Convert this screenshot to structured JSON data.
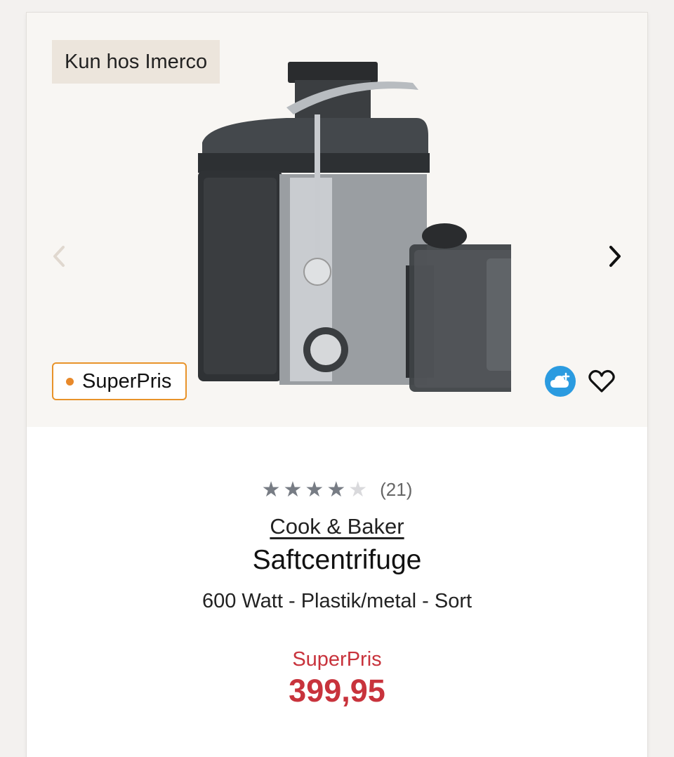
{
  "product": {
    "exclusive_tag": "Kun hos Imerco",
    "badge_label": "SuperPris",
    "rating": {
      "stars_filled": 4,
      "stars_total": 5,
      "count": "(21)"
    },
    "brand": "Cook & Baker",
    "name": "Saftcentrifuge",
    "variant": "600 Watt - Plastik/metal - Sort",
    "price_label": "SuperPris",
    "price": "399,95"
  },
  "icons": {
    "prev": "chevron-left-icon",
    "next": "chevron-right-icon",
    "cloud": "cloud-plus-icon",
    "favorite": "heart-icon"
  },
  "colors": {
    "price_red": "#c8333c",
    "badge_orange": "#e8932a",
    "cloud_blue": "#2b9be0",
    "star_filled": "#777c84",
    "star_empty": "#d9d9dc"
  }
}
